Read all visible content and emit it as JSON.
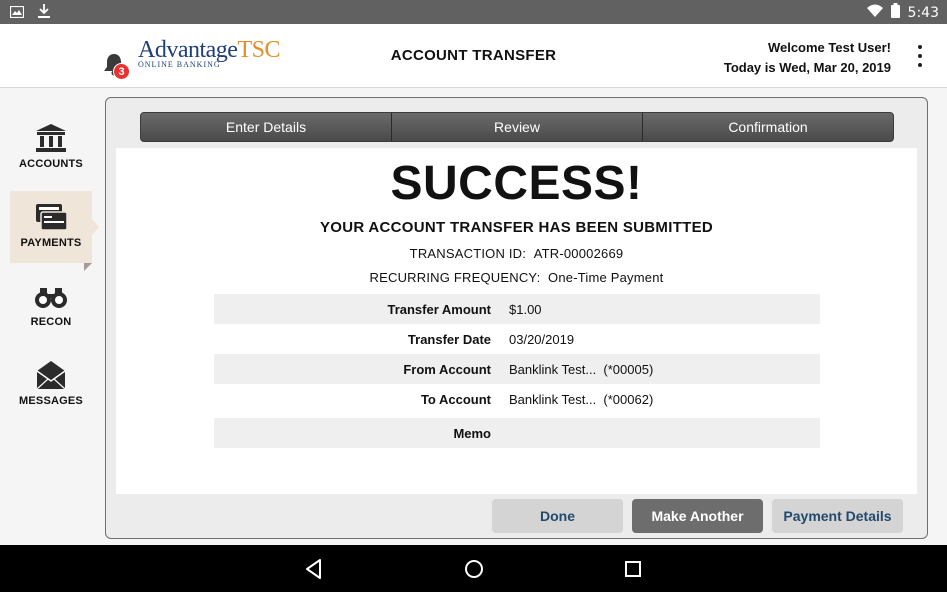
{
  "status_bar": {
    "time": "5:43",
    "left_icons": [
      "image-icon",
      "download-icon"
    ],
    "right_icons": [
      "wifi-icon",
      "battery-icon"
    ]
  },
  "header": {
    "notification_count": "3",
    "logo_main": "Advantage",
    "logo_accent": "TSC",
    "logo_tagline": "ONLINE BANKING",
    "title": "ACCOUNT TRANSFER",
    "welcome": "Welcome Test User!",
    "date": "Today is Wed, Mar 20, 2019"
  },
  "sidebar": {
    "items": [
      {
        "label": "ACCOUNTS",
        "icon": "bank-icon"
      },
      {
        "label": "PAYMENTS",
        "icon": "payments-icon",
        "active": true
      },
      {
        "label": "RECON",
        "icon": "binoculars-icon"
      },
      {
        "label": "MESSAGES",
        "icon": "envelope-icon"
      }
    ]
  },
  "steps": [
    "Enter Details",
    "Review",
    "Confirmation"
  ],
  "result": {
    "headline": "SUCCESS!",
    "message": "YOUR ACCOUNT TRANSFER HAS BEEN SUBMITTED",
    "transaction_label": "TRANSACTION ID:",
    "transaction_id": "ATR-00002669",
    "frequency_label": "RECURRING FREQUENCY:",
    "frequency": "One-Time Payment"
  },
  "details": [
    {
      "label": "Transfer Amount",
      "value": "$1.00"
    },
    {
      "label": "Transfer Date",
      "value": "03/20/2019"
    },
    {
      "label": "From Account",
      "value": "Banklink Test...  (*00005)"
    },
    {
      "label": "To Account",
      "value": "Banklink Test...  (*00062)"
    },
    {
      "label": "Memo",
      "value": ""
    }
  ],
  "buttons": {
    "done": "Done",
    "make_another": "Make Another",
    "payment_details": "Payment Details"
  },
  "colors": {
    "status_bar": "#616161",
    "button_text": "#234a6d",
    "badge": "#e8322f",
    "active_nav": "#efe5d8"
  }
}
